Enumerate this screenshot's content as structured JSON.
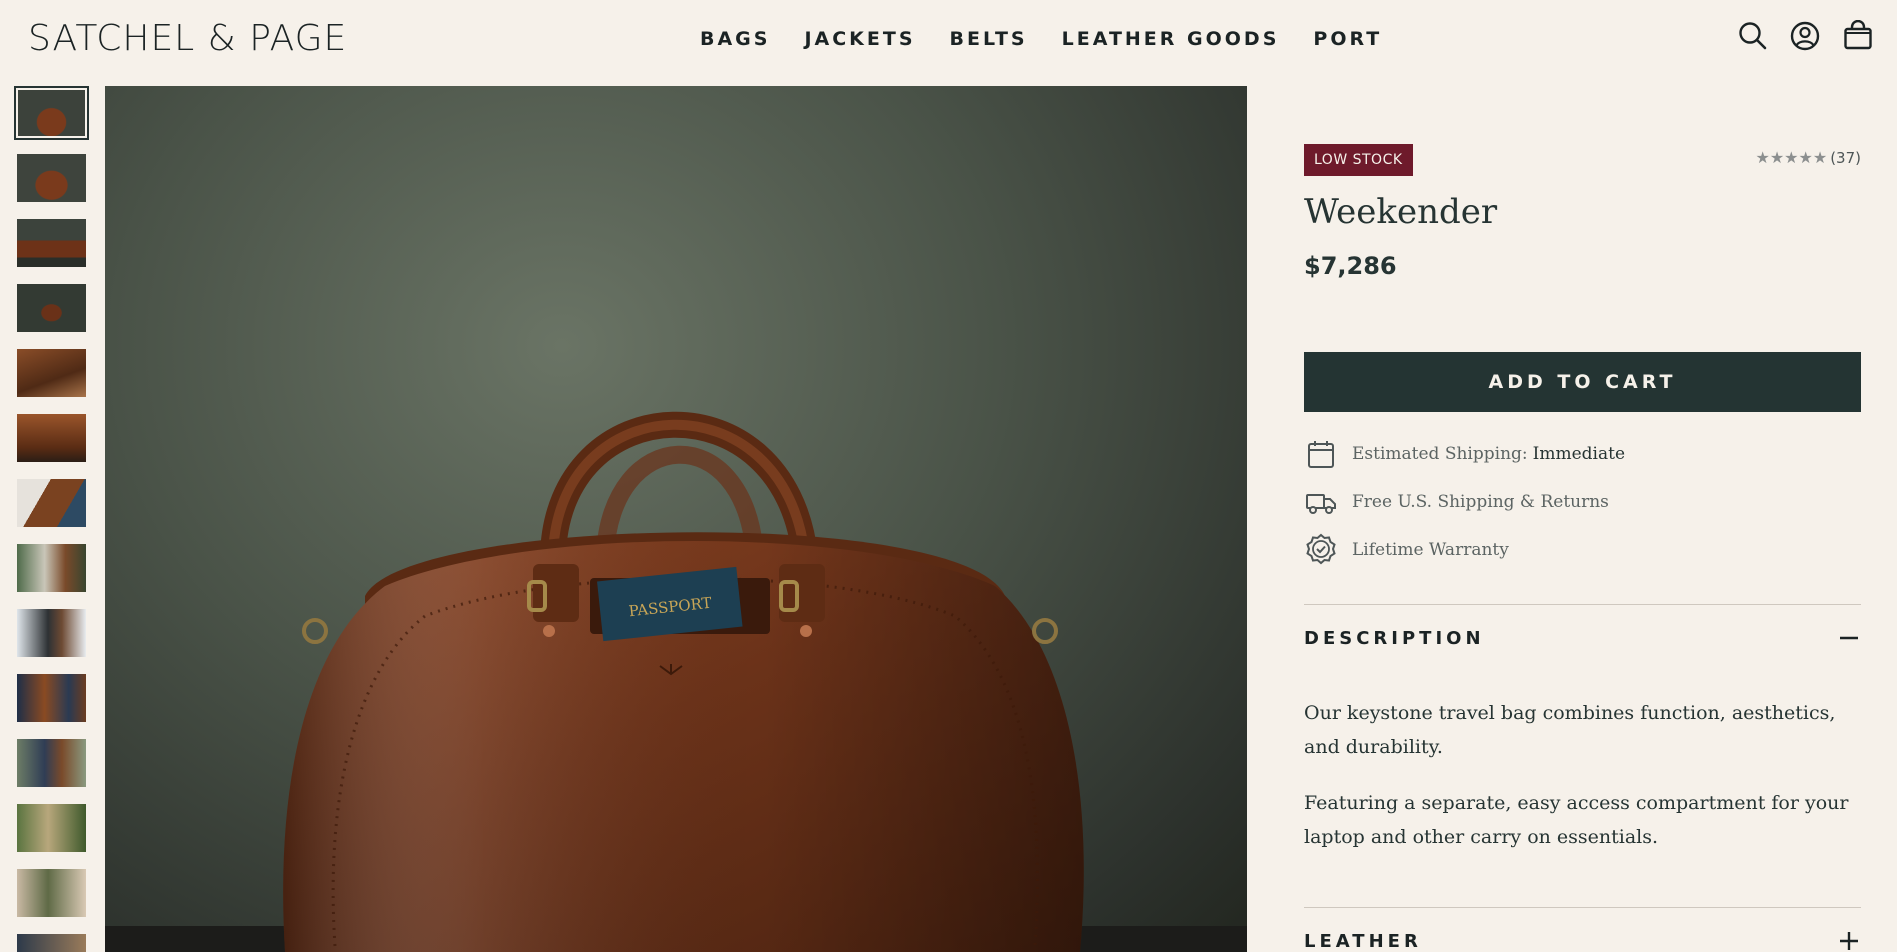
{
  "brand": {
    "logo_text": "SATCHEL & PAGE"
  },
  "nav": {
    "items": [
      {
        "label": "BAGS"
      },
      {
        "label": "JACKETS"
      },
      {
        "label": "BELTS"
      },
      {
        "label": "LEATHER GOODS"
      },
      {
        "label": "PORT"
      }
    ]
  },
  "header_icons": [
    "search-icon",
    "account-icon",
    "cart-icon"
  ],
  "gallery": {
    "thumbnail_count": 14,
    "active_index": 0,
    "main_image": {
      "label": "PASSPORT"
    }
  },
  "product": {
    "badge": "LOW STOCK",
    "rating_count": "(37)",
    "rating_stars": 5,
    "title": "Weekender",
    "price": "$7,286",
    "add_to_cart_label": "ADD TO CART",
    "features": [
      {
        "icon": "calendar-icon",
        "text": "Estimated Shipping:",
        "strong": "Immediate"
      },
      {
        "icon": "truck-icon",
        "text": "Free U.S. Shipping & Returns",
        "strong": ""
      },
      {
        "icon": "warranty-badge-icon",
        "text": "Lifetime Warranty",
        "strong": ""
      }
    ],
    "accordions": [
      {
        "title": "DESCRIPTION",
        "expanded": true,
        "paragraphs": [
          "Our keystone travel bag combines function, aesthetics, and durability.",
          "Featuring a separate, easy access compartment for your laptop and other carry on essentials."
        ]
      },
      {
        "title": "LEATHER",
        "expanded": false,
        "paragraphs": []
      }
    ]
  },
  "colors": {
    "background": "#f6f1ea",
    "primary_dark": "#243433",
    "badge_burgundy": "#6e1a2b",
    "leather_brown": "#6b3219"
  }
}
